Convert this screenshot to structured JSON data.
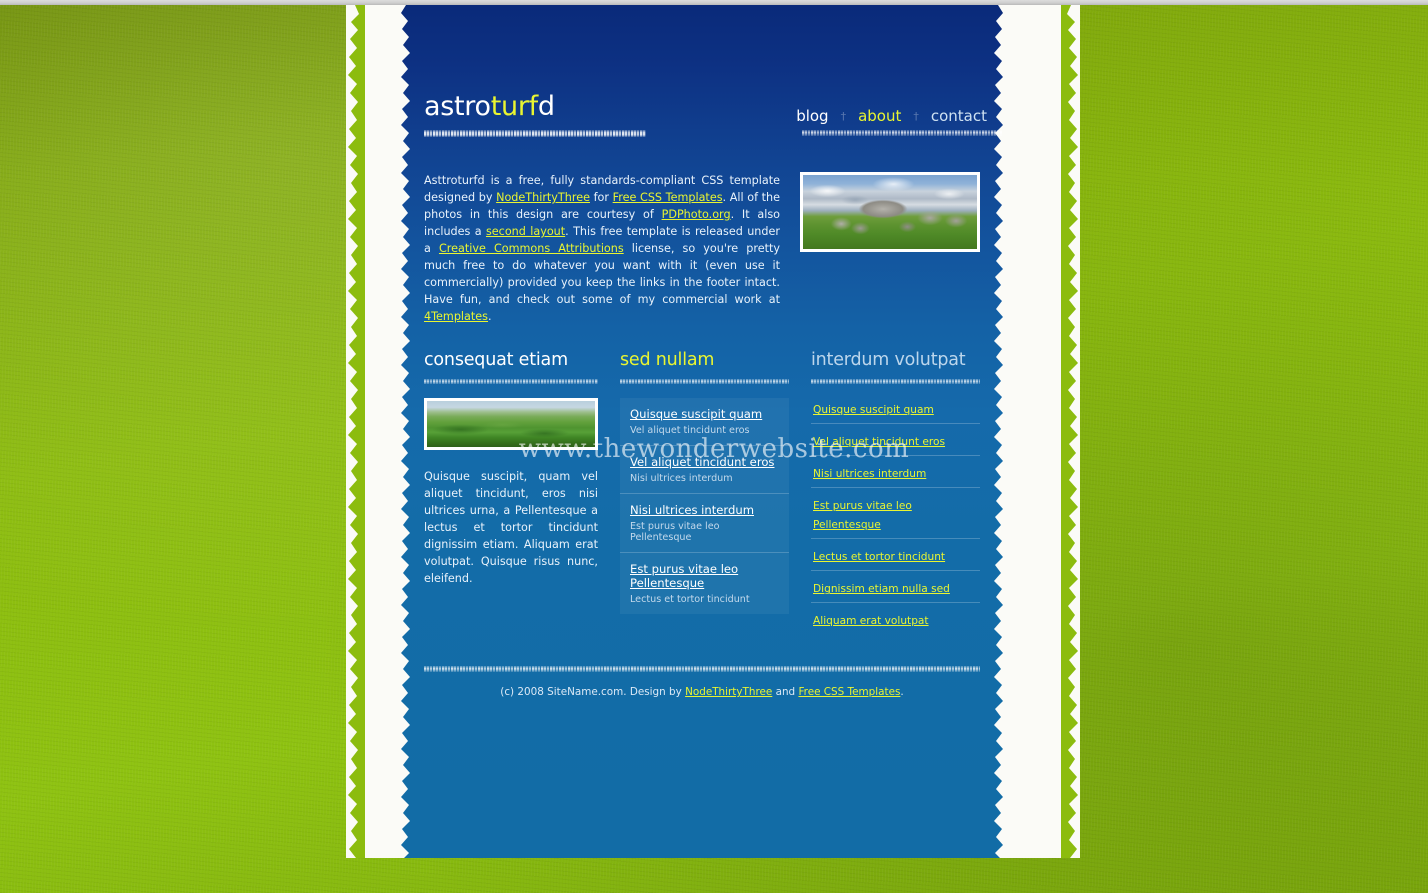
{
  "site": {
    "logo_part1": "astro",
    "logo_part2": "turf",
    "logo_part3": "d",
    "accent_yellow": "#e9f531",
    "blue_top": "#0a2a7a",
    "blue_bottom": "#126ca6",
    "green_bg": "#8cbc0e"
  },
  "nav": {
    "items": [
      {
        "label": "blog",
        "state": "normal"
      },
      {
        "label": "about",
        "state": "active"
      },
      {
        "label": "contact",
        "state": "dim"
      }
    ],
    "separator": "†"
  },
  "intro": {
    "text_1": "Asttroturfd is a free, fully standards-compliant CSS template designed by ",
    "link_1": "NodeThirtyThree",
    "text_2": " for ",
    "link_2": "Free CSS Templates",
    "text_3": ". All of the photos in this design are courtesy of ",
    "link_3": "PDPhoto.org",
    "text_4": ". It also includes a ",
    "link_4": "second layout",
    "text_5": ". This free template is released under a ",
    "link_5": "Creative Commons Attributions",
    "text_6": " license, so you're pretty much free to do whatever you want with it (even use it commercially) provided you keep the links in the footer intact. Have fun, and check out some of my commercial work at ",
    "link_6": "4Templates",
    "text_7": ".",
    "photo_alt": "rocky-hill-landscape-photo"
  },
  "columns": {
    "left": {
      "heading": "consequat etiam",
      "photo_alt": "green-countryside-photo",
      "body": "Quisque suscipit, quam vel aliquet tincidunt, eros nisi ultrices urna, a Pellentesque a lectus et tortor tincidunt dignissim etiam. Aliquam erat volutpat. Quisque risus nunc, eleifend."
    },
    "middle": {
      "heading": "sed nullam",
      "items": [
        {
          "title": "Quisque suscipit quam",
          "subtitle": "Vel aliquet tincidunt eros"
        },
        {
          "title": "Vel aliquet tincidunt eros",
          "subtitle": "Nisi ultrices interdum"
        },
        {
          "title": "Nisi ultrices interdum",
          "subtitle": "Est purus vitae leo Pellentesque"
        },
        {
          "title": "Est purus vitae leo Pellentesque",
          "subtitle": "Lectus et tortor tincidunt"
        }
      ]
    },
    "right": {
      "heading": "interdum volutpat",
      "links": [
        "Quisque suscipit quam",
        "Vel aliquet tincidunt eros",
        "Nisi ultrices interdum",
        "Est purus vitae leo Pellentesque",
        "Lectus et tortor tincidunt",
        "Dignissim etiam nulla sed",
        "Aliquam erat volutpat"
      ]
    }
  },
  "footer": {
    "text_1": "(c) 2008 SiteName.com. Design by ",
    "link_1": "NodeThirtyThree",
    "text_2": " and ",
    "link_2": "Free CSS Templates",
    "text_3": "."
  },
  "watermark": {
    "text": "www.thewonderwebsite.com"
  }
}
